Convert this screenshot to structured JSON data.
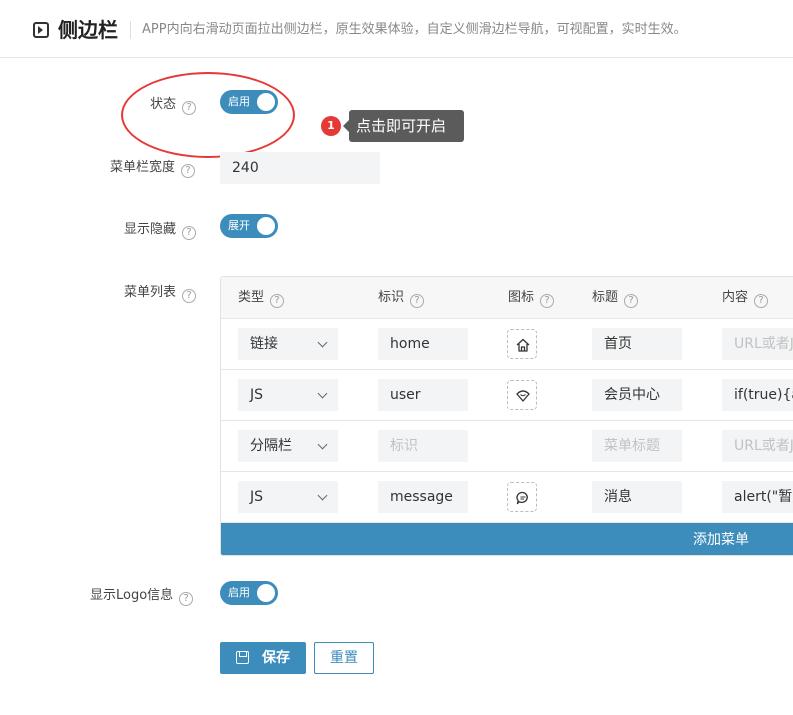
{
  "header": {
    "title": "侧边栏",
    "description": "APP内向右滑动页面拉出侧边栏，原生效果体验，自定义侧滑边栏导航，可视配置，实时生效。"
  },
  "form": {
    "status": {
      "label": "状态",
      "toggle_text": "启用",
      "enabled": true
    },
    "tooltip": {
      "badge": "1",
      "text": "点击即可开启"
    },
    "menu_width": {
      "label": "菜单栏宽度",
      "value": "240"
    },
    "show_hide": {
      "label": "显示隐藏",
      "toggle_text": "展开",
      "enabled": true
    },
    "menu_list": {
      "label": "菜单列表",
      "columns": [
        "类型",
        "标识",
        "图标",
        "标题",
        "内容"
      ],
      "rows": [
        {
          "type": "链接",
          "id": "home",
          "id_placeholder": "",
          "icon": "home-icon",
          "title": "首页",
          "title_placeholder": "",
          "content": "",
          "content_placeholder": "URL或者J"
        },
        {
          "type": "JS",
          "id": "user",
          "id_placeholder": "",
          "icon": "heart-chat-icon",
          "title": "会员中心",
          "title_placeholder": "",
          "content": "if(true){a",
          "content_placeholder": ""
        },
        {
          "type": "分隔栏",
          "id": "",
          "id_placeholder": "标识",
          "icon": "",
          "title": "",
          "title_placeholder": "菜单标题",
          "content": "",
          "content_placeholder": "URL或者J"
        },
        {
          "type": "JS",
          "id": "message",
          "id_placeholder": "",
          "icon": "message-icon",
          "title": "消息",
          "title_placeholder": "",
          "content": "alert(\"暂无",
          "content_placeholder": ""
        }
      ],
      "add_button": "添加菜单"
    },
    "show_logo": {
      "label": "显示Logo信息",
      "toggle_text": "启用",
      "enabled": true
    }
  },
  "actions": {
    "save": "保存",
    "reset": "重置"
  },
  "colors": {
    "primary": "#3d8dbc",
    "annotation": "#e53935"
  }
}
